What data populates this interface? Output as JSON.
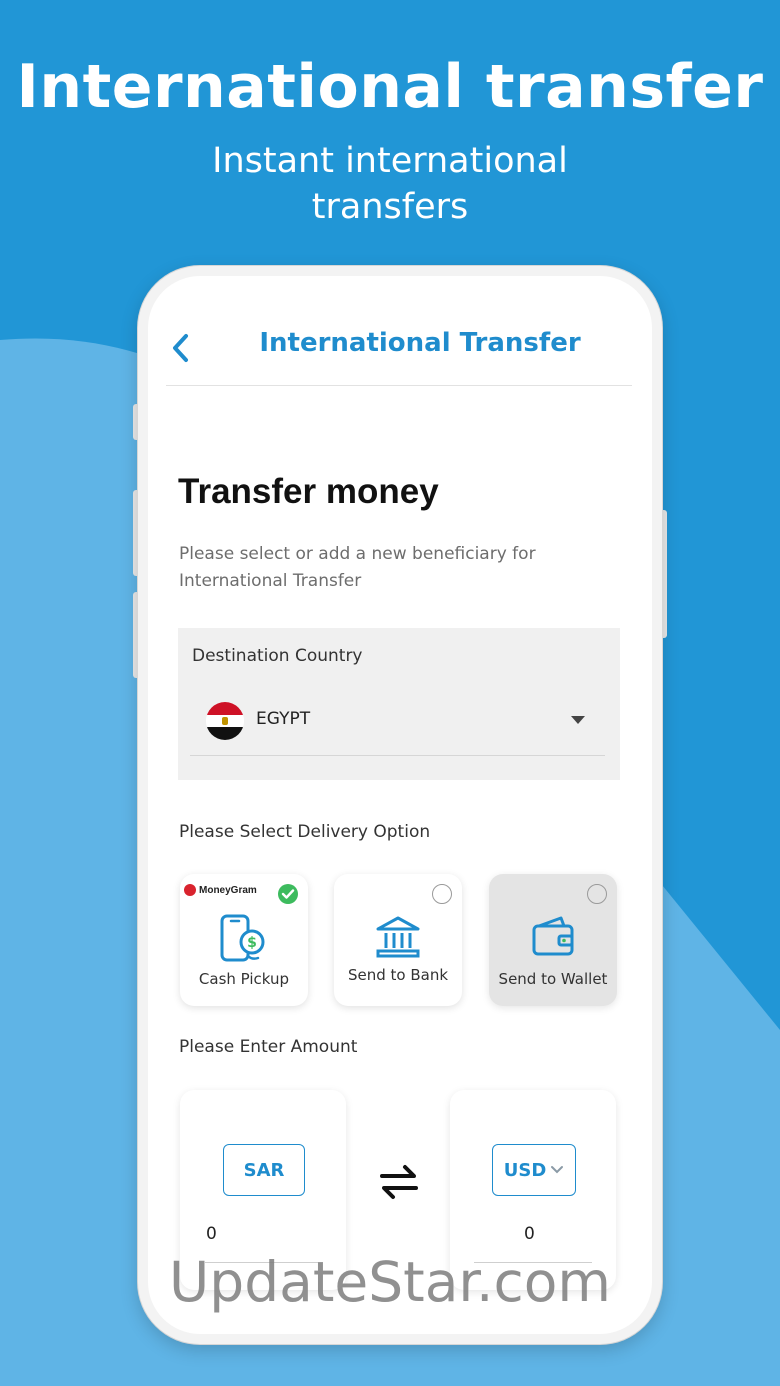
{
  "hero": {
    "title": "International transfer",
    "subtitle": "Instant international transfers"
  },
  "header": {
    "back_icon": "chevron-left-icon",
    "title": "International Transfer"
  },
  "main": {
    "title": "Transfer money",
    "description": "Please select or add a new beneficiary for International Transfer",
    "destination": {
      "label": "Destination Country",
      "selected_country": "EGYPT",
      "flag_icon": "egypt-flag-icon"
    },
    "delivery": {
      "label": "Please Select Delivery Option",
      "options": [
        {
          "label": "Cash Pickup",
          "provider": "MoneyGram",
          "icon": "cash-pickup-icon",
          "selected": true
        },
        {
          "label": "Send to Bank",
          "icon": "bank-icon",
          "selected": false
        },
        {
          "label": "Send to Wallet",
          "icon": "wallet-icon",
          "selected": false,
          "disabled": true
        }
      ]
    },
    "amount": {
      "label": "Please Enter Amount",
      "from_currency": "SAR",
      "from_value": "0",
      "to_currency": "USD",
      "to_value": "0"
    }
  },
  "watermark": "UpdateStar.com",
  "colors": {
    "background": "#2196d6",
    "accent": "#1f8ccd",
    "selected": "#3dbb5e",
    "moneygram_red": "#d9232e"
  }
}
